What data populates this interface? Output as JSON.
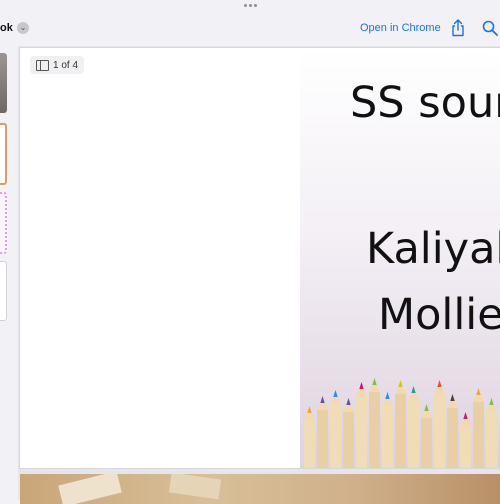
{
  "toolbar": {
    "doc_title": "ok",
    "open_in_chrome": "Open in Chrome",
    "icons": [
      "more-dots-icon",
      "chevron-down-icon",
      "share-icon",
      "search-icon"
    ]
  },
  "viewer": {
    "page_indicator": "1 of 4"
  },
  "slide": {
    "line1": "SS sour",
    "line2": "Kaliyah",
    "line3": "Mollie"
  },
  "colors": {
    "accent": "#1a73e8",
    "background": "#f2f2f6"
  }
}
